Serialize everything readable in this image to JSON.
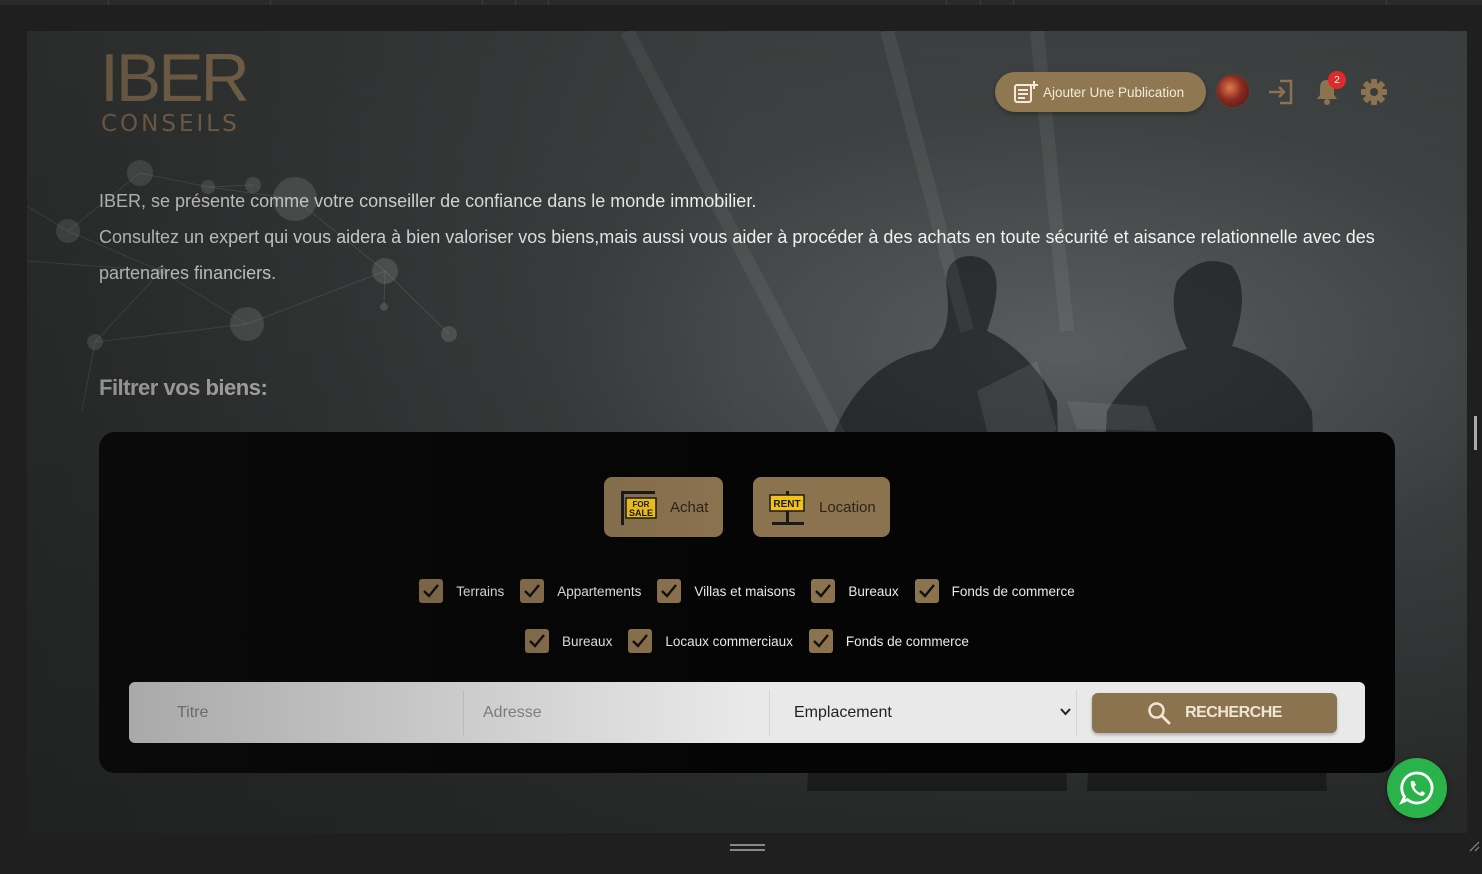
{
  "brand": {
    "logo_main": "IBER",
    "logo_sub": "CONSEILS"
  },
  "header": {
    "add_post_label": "Ajouter Une Publication",
    "notification_count": "2"
  },
  "intro": {
    "line1": "IBER, se présente comme votre conseiller de confiance dans le monde immobilier.",
    "line2": "Consultez un expert qui vous aidera à bien valoriser vos biens,mais aussi vous aider à procéder à des achats en toute sécurité et aisance relationnelle avec des partenaires financiers."
  },
  "filter": {
    "title": "Filtrer vos biens:",
    "types": [
      {
        "label": "Achat",
        "sign": [
          "FOR",
          "SALE"
        ]
      },
      {
        "label": "Location",
        "sign": [
          "RENT"
        ]
      }
    ],
    "row1": [
      "Terrains",
      "Appartements",
      "Villas et maisons",
      "Bureaux",
      "Fonds de commerce"
    ],
    "row2": [
      "Bureaux",
      "Locaux commerciaux",
      "Fonds de commerce"
    ]
  },
  "search": {
    "title_placeholder": "Titre",
    "address_placeholder": "Adresse",
    "location_selected": "Emplacement",
    "button_label": "RECHERCHE"
  },
  "colors": {
    "accent": "#8c7350",
    "logo": "#8a7254",
    "panel": "#050505",
    "badge": "#e02a2a",
    "whatsapp": "#2ab34a"
  }
}
